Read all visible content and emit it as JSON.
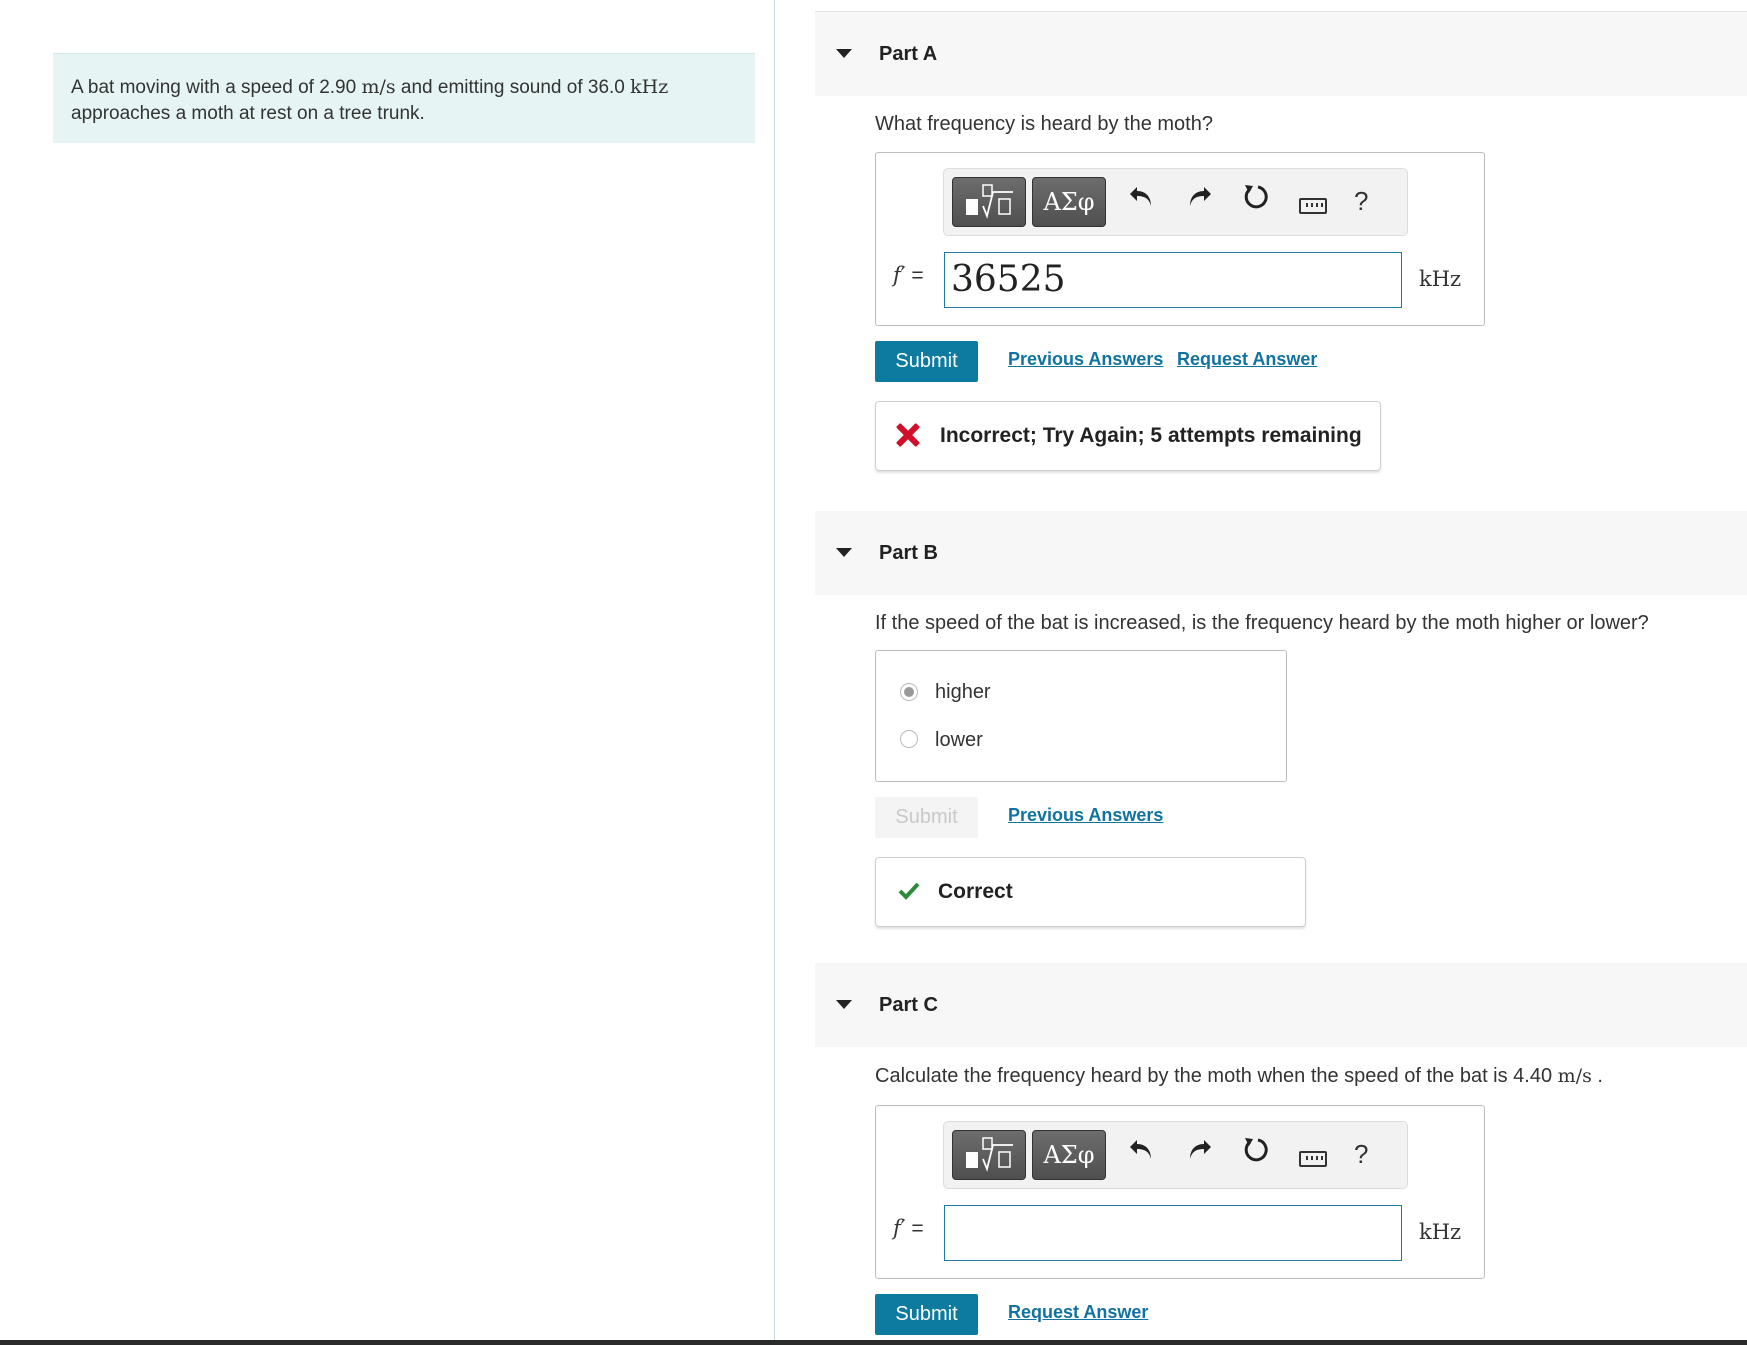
{
  "problem": {
    "text_prefix": "A bat moving with a speed of 2.90",
    "speed_unit": "m/s",
    "text_mid": "and emitting sound of 36.0",
    "freq_unit": "kHz",
    "text_suffix": "approaches a moth at rest on a tree trunk."
  },
  "toolbar": {
    "templates_icon": "templates-icon",
    "greek_label": "ΑΣφ",
    "undo_icon": "undo-icon",
    "redo_icon": "redo-icon",
    "reset_icon": "reset-icon",
    "keyboard_icon": "keyboard-icon",
    "help_label": "?"
  },
  "part_a": {
    "title": "Part A",
    "question": "What frequency is heard by the moth?",
    "var_label": "f′",
    "equals": "=",
    "input_value": "36525",
    "unit": "kHz",
    "submit_label": "Submit",
    "previous_answers_label": "Previous Answers",
    "request_answer_label": "Request Answer",
    "feedback": "Incorrect; Try Again; 5 attempts remaining"
  },
  "part_b": {
    "title": "Part B",
    "question": "If the speed of the bat is increased, is the frequency heard by the moth higher or lower?",
    "options": [
      {
        "label": "higher",
        "selected": true
      },
      {
        "label": "lower",
        "selected": false
      }
    ],
    "submit_label": "Submit",
    "previous_answers_label": "Previous Answers",
    "feedback": "Correct"
  },
  "part_c": {
    "title": "Part C",
    "question_prefix": "Calculate the frequency heard by the moth when the speed of the bat is 4.40",
    "speed_unit": "m/s",
    "question_suffix": ".",
    "var_label": "f′",
    "equals": "=",
    "input_value": "",
    "unit": "kHz",
    "submit_label": "Submit",
    "request_answer_label": "Request Answer"
  },
  "colors": {
    "accent": "#0d7aa0",
    "link": "#1073a0",
    "incorrect": "#d10f2a",
    "correct": "#2e8b3a",
    "problem_bg": "#e6f4f4"
  }
}
